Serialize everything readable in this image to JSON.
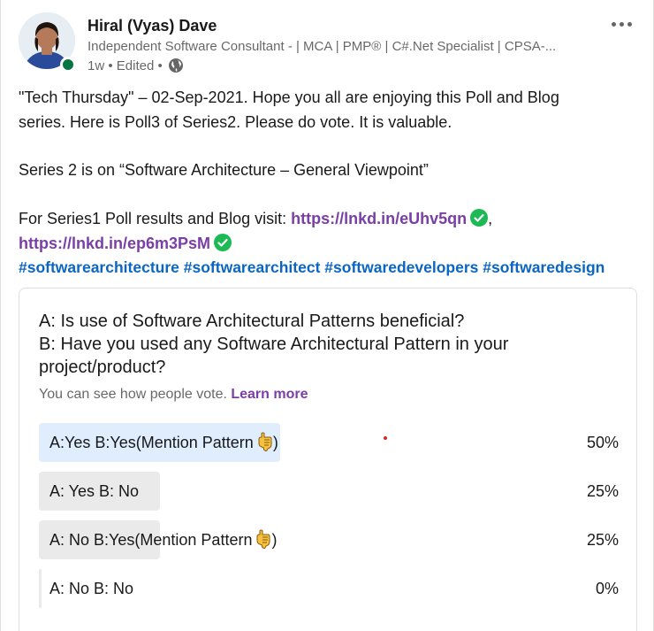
{
  "author": {
    "name": "Hiral (Vyas) Dave",
    "headline": "Independent Software Consultant - | MCA | PMP® | C#.Net Specialist | CPSA-...",
    "meta": "1w • Edited •",
    "online": true
  },
  "post": {
    "line1": "\"Tech Thursday\" – 02-Sep-2021. Hope you all are enjoying this Poll and Blog",
    "line2": "series. Here is Poll3 of Series2. Please do vote. It is valuable.",
    "line3": "Series 2 is on “Software Architecture – General Viewpoint”",
    "line4_prefix": "For Series1 Poll results and Blog visit: ",
    "link1": "https://lnkd.in/eUhv5qn",
    "link1_suffix": ",",
    "link2": "https://lnkd.in/ep6m3PsM",
    "hashtags": [
      "#softwarearchitecture",
      "#softwarearchitect",
      "#softwaredevelopers",
      "#softwaredesign"
    ]
  },
  "poll": {
    "question_a": "A: Is use of Software Architectural Patterns beneficial?",
    "question_b": "B: Have you used any Software Architectural Pattern in your project/product?",
    "subtitle": "You can see how people vote.",
    "learn_more": "Learn more",
    "options": [
      {
        "label": "A:Yes B:Yes(Mention Pattern",
        "suffix": ")",
        "percent": "50%",
        "share": 0.5,
        "selected": true,
        "hand_icon": true
      },
      {
        "label": "A: Yes B: No",
        "suffix": "",
        "percent": "25%",
        "share": 0.25,
        "selected": false,
        "hand_icon": false
      },
      {
        "label": "A: No B:Yes(Mention Pattern",
        "suffix": ")",
        "percent": "25%",
        "share": 0.25,
        "selected": false,
        "hand_icon": true
      },
      {
        "label": "A: No B: No",
        "suffix": "",
        "percent": "0%",
        "share": 0,
        "selected": false,
        "hand_icon": false
      }
    ]
  },
  "colors": {
    "link": "#7a3ea7",
    "hashtag": "#0a66c2",
    "selected_bar": "#dfedfd",
    "bar": "#eaeaea",
    "presence": "#057642",
    "check": "#1db954"
  },
  "icons": [
    "more-options-icon",
    "globe-icon",
    "check-icon",
    "hand-pointing-down-icon"
  ]
}
